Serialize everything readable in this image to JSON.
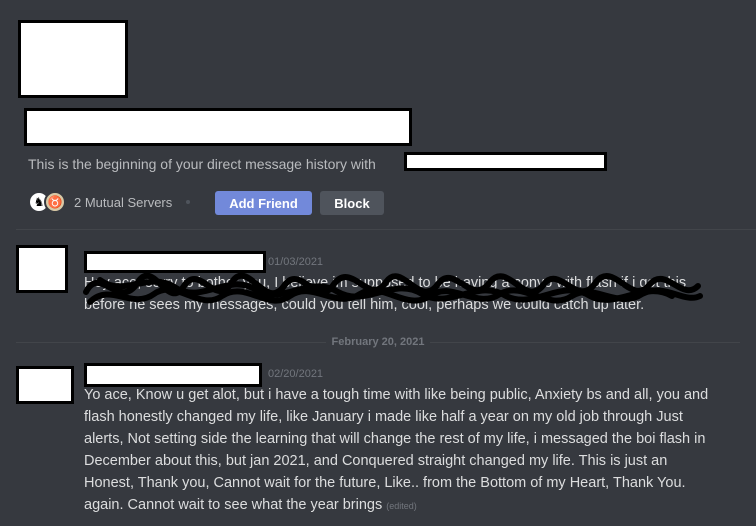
{
  "intro": {
    "text": "This is the beginning of your direct message history with"
  },
  "mutual": {
    "count_label": "2 Mutual Servers"
  },
  "actions": {
    "add_friend": "Add Friend",
    "block": "Block"
  },
  "messages": [
    {
      "timestamp": "01/03/2021",
      "text": "Hey ace, sorry to bother you, I believe im supposed to be having a convo with flash if i got this before he sees my messages, could you tell him, cool, perhaps we could catch up later."
    },
    {
      "timestamp": "02/20/2021",
      "text": "Yo ace, Know u get alot, but i have a tough time with like being public, Anxiety bs and all, you and flash honestly changed my life, like January i made like half a year on my old job through Just alerts, Not setting side the learning that will change the rest of my life, i messaged the boi flash in December about this, but jan 2021, and Conquered straight changed my life. This is just an Honest, Thank you, Cannot wait for the future, Like.. from the Bottom of my Heart, Thank You. again. Cannot wait to see what the year brings",
      "edited": "(edited)"
    }
  ],
  "date_separator": "February 20, 2021",
  "colors": {
    "background": "#36393f",
    "accent": "#7289da",
    "secondary_button": "#4f545c",
    "text": "#dcddde",
    "muted": "#72767d"
  }
}
